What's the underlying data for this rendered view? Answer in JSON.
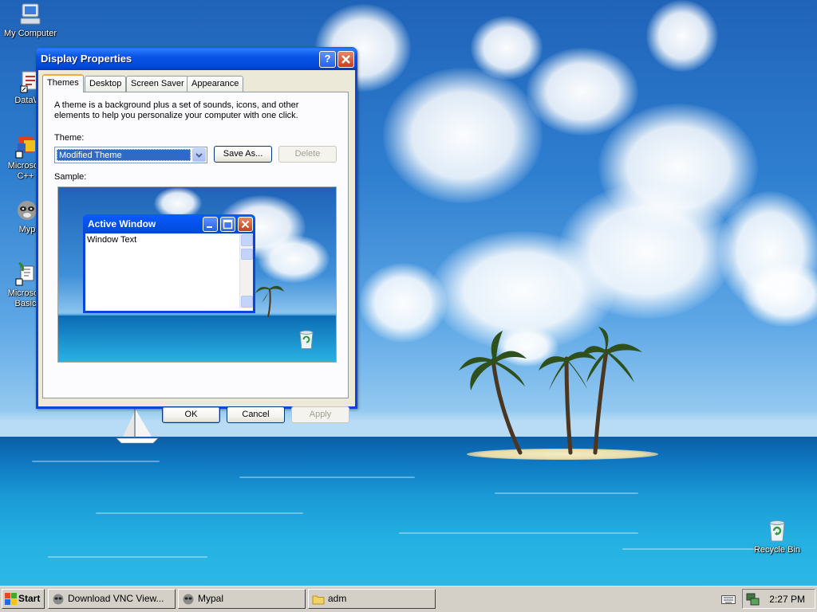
{
  "desktop": {
    "icons": [
      {
        "label": "My Computer"
      },
      {
        "label": "DataWa"
      },
      {
        "label": "Microsoft\nC++"
      },
      {
        "label": "Myp"
      },
      {
        "label": "Microsoft\nBasic"
      },
      {
        "label": "Recycle Bin"
      }
    ]
  },
  "dialog": {
    "title": "Display Properties",
    "help_label": "?",
    "tabs": [
      {
        "label": "Themes",
        "active": true
      },
      {
        "label": "Desktop"
      },
      {
        "label": "Screen Saver"
      },
      {
        "label": "Appearance"
      }
    ],
    "description": "A theme is a background plus a set of sounds, icons, and other elements to help you personalize your computer with one click.",
    "theme_label": "Theme:",
    "theme_value": "Modified Theme",
    "save_as_label": "Save As...",
    "delete_label": "Delete",
    "sample_label": "Sample:",
    "sample": {
      "window_title": "Active Window",
      "window_text": "Window Text"
    },
    "ok_label": "OK",
    "cancel_label": "Cancel",
    "apply_label": "Apply"
  },
  "taskbar": {
    "start_label": "Start",
    "tasks": [
      {
        "label": "Download VNC View..."
      },
      {
        "label": "Mypal"
      },
      {
        "label": "adm"
      }
    ],
    "clock": "2:27 PM"
  }
}
